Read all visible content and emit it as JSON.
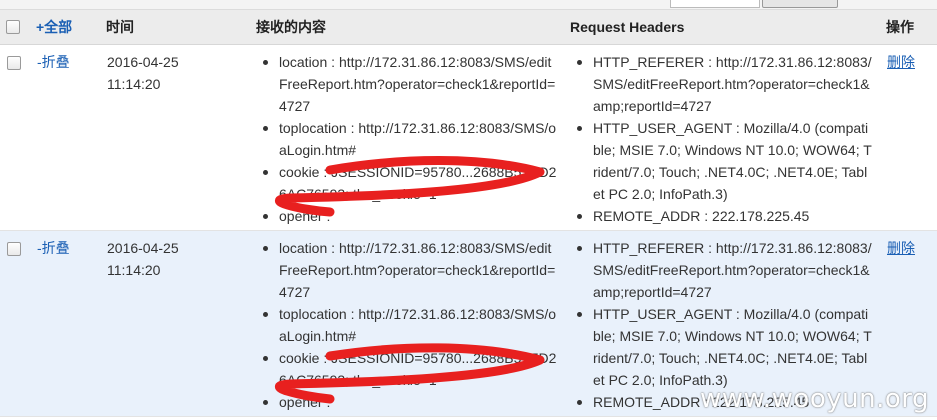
{
  "header": {
    "select_all": "+全部",
    "time": "时间",
    "content": "接收的内容",
    "headers": "Request Headers",
    "action": "操作"
  },
  "rows": [
    {
      "fold": "-折叠",
      "date": "2016-04-25",
      "time": "11:14:20",
      "content": [
        {
          "k": "location",
          "v": "http://172.31.86.12:8083/SMS/editFreeReport.htm?operator=check1&reportId=4727"
        },
        {
          "k": "toplocation",
          "v": "http://172.31.86.12:8083/SMS/oaLogin.htm#"
        },
        {
          "k": "cookie",
          "v": "JSESSIONID=95780...2688B51ED26AC76593; the_cookie=1"
        },
        {
          "k": "opener",
          "v": ""
        }
      ],
      "headers": [
        {
          "k": "HTTP_REFERER",
          "v": "http://172.31.86.12:8083/SMS/editFreeReport.htm?operator=check1&amp;reportId=4727"
        },
        {
          "k": "HTTP_USER_AGENT",
          "v": "Mozilla/4.0 (compatible; MSIE 7.0; Windows NT 10.0; WOW64; Trident/7.0; Touch; .NET4.0C; .NET4.0E; Tablet PC 2.0; InfoPath.3)"
        },
        {
          "k": "REMOTE_ADDR",
          "v": "222.178.225.45"
        }
      ],
      "action": "删除"
    },
    {
      "fold": "-折叠",
      "date": "2016-04-25",
      "time": "11:14:20",
      "content": [
        {
          "k": "location",
          "v": "http://172.31.86.12:8083/SMS/editFreeReport.htm?operator=check1&reportId=4727"
        },
        {
          "k": "toplocation",
          "v": "http://172.31.86.12:8083/SMS/oaLogin.htm#"
        },
        {
          "k": "cookie",
          "v": "JSESSIONID=95780...2688B51ED26AC76593; the_cookie=1"
        },
        {
          "k": "opener",
          "v": ""
        }
      ],
      "headers": [
        {
          "k": "HTTP_REFERER",
          "v": "http://172.31.86.12:8083/SMS/editFreeReport.htm?operator=check1&amp;reportId=4727"
        },
        {
          "k": "HTTP_USER_AGENT",
          "v": "Mozilla/4.0 (compatible; MSIE 7.0; Windows NT 10.0; WOW64; Trident/7.0; Touch; .NET4.0C; .NET4.0E; Tablet PC 2.0; InfoPath.3)"
        },
        {
          "k": "REMOTE_ADDR",
          "v": "222.178.225.45"
        }
      ],
      "action": "删除"
    }
  ],
  "watermark": "www.wooyun.org",
  "colors": {
    "header_bg": "#ececec",
    "alt_row_bg": "#e9f1fb",
    "link": "#1a5fb4",
    "redaction": "#e8201f"
  }
}
